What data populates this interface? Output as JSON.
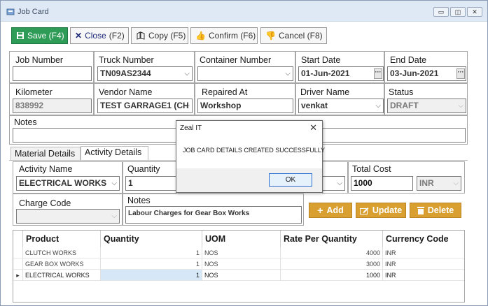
{
  "window": {
    "title": "Job Card",
    "controls": {
      "minimize": "▭",
      "restore": "◫",
      "close": "✕"
    }
  },
  "toolbar": {
    "save_label": "Save (F4)",
    "close_label": "Close",
    "close_shortcut": "(F2)",
    "copy_label": "Copy (F5)",
    "confirm_label": "Confirm (F6)",
    "cancel_label": "Cancel (F8)"
  },
  "header_form": {
    "job_number": {
      "label": "Job Number",
      "value": ""
    },
    "truck_number": {
      "label": "Truck Number",
      "value": "TN09AS2344"
    },
    "container_number": {
      "label": "Container Number",
      "value": ""
    },
    "start_date": {
      "label": "Start Date",
      "value": "01-Jun-2021"
    },
    "end_date": {
      "label": "End Date",
      "value": "03-Jun-2021"
    },
    "kilometer": {
      "label": "Kilometer",
      "value": "838992"
    },
    "vendor_name": {
      "label": "Vendor Name",
      "value": "TEST GARRAGE1 (CH"
    },
    "repaired_at": {
      "label": "Repaired At",
      "value": "Workshop"
    },
    "driver_name": {
      "label": "Driver Name",
      "value": "venkat"
    },
    "status": {
      "label": "Status",
      "value": "DRAFT"
    },
    "notes": {
      "label": "Notes",
      "value": ""
    }
  },
  "tabs": [
    {
      "label": "Material Details"
    },
    {
      "label": "Activity Details"
    }
  ],
  "activity_form": {
    "activity_name": {
      "label": "Activity Name",
      "value": "ELECTRICAL WORKS"
    },
    "quantity": {
      "label": "Quantity",
      "value": "1"
    },
    "total_cost": {
      "label": "Total Cost",
      "value": "1000"
    },
    "currency": "INR",
    "charge_code": {
      "label": "Charge Code",
      "value": ""
    },
    "notes": {
      "label": "Notes",
      "value": "Labour Charges for Gear Box Works"
    }
  },
  "actions": {
    "add": "Add",
    "update": "Update",
    "delete": "Delete"
  },
  "grid": {
    "columns": [
      "Product",
      "Quantity",
      "UOM",
      "Rate Per Quantity",
      "Currency Code"
    ],
    "rows": [
      [
        "CLUTCH WORKS",
        "1",
        "NOS",
        "4000",
        "INR"
      ],
      [
        "GEAR BOX WORKS",
        "1",
        "NOS",
        "3000",
        "INR"
      ],
      [
        "ELECTRICAL WORKS",
        "1",
        "NOS",
        "1000",
        "INR"
      ]
    ],
    "selected_row": 2,
    "row_indicator": "▸"
  },
  "dialog": {
    "title": "Zeal IT",
    "message": "JOB CARD DETAILS CREATED SUCCESSFULLY",
    "ok_label": "OK"
  },
  "colors": {
    "save_button": "#2e9b57",
    "action_buttons": "#d9a031",
    "selected_row": "#d6e8f7"
  }
}
